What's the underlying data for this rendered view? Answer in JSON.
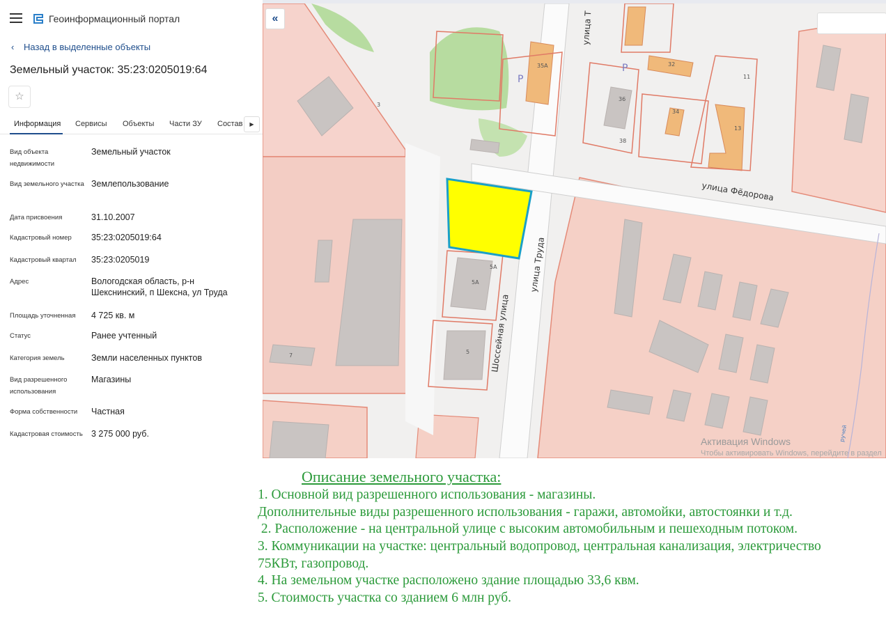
{
  "app": {
    "title": "Геоинформационный портал"
  },
  "panel": {
    "back_label": "Назад в выделенные объекты",
    "title": "Земельный участок: 35:23:0205019:64",
    "tabs": [
      "Информация",
      "Сервисы",
      "Объекты",
      "Части ЗУ",
      "Состав"
    ],
    "properties": [
      {
        "label": "Вид объекта недвижимости",
        "value": "Земельный участок"
      },
      {
        "label": "Вид земельного участка",
        "value": "Землепользование"
      },
      {
        "label": "Дата присвоения",
        "value": "31.10.2007"
      },
      {
        "label": "Кадастровый номер",
        "value": "35:23:0205019:64"
      },
      {
        "label": "Кадастровый квартал",
        "value": "35:23:0205019"
      },
      {
        "label": "Адрес",
        "value": "Вологодская область, р-н Шекснинский, п Шексна, ул Труда"
      },
      {
        "label": "Площадь уточненная",
        "value": "4 725 кв. м"
      },
      {
        "label": "Статус",
        "value": "Ранее учтенный"
      },
      {
        "label": "Категория земель",
        "value": "Земли населенных пунктов"
      },
      {
        "label": "Вид разрешенного использования",
        "value": "Магазины"
      },
      {
        "label": "Форма собственности",
        "value": "Частная"
      },
      {
        "label": "Кадастровая стоимость",
        "value": "3 275 000 руб."
      }
    ]
  },
  "map": {
    "streets": {
      "fedorova": "улица Фёдорова",
      "truda": "улица Труда",
      "truda_top": "улица Т",
      "shosseynaya": "Шоссейная улица",
      "ruchey": "ручей"
    },
    "building_numbers": [
      "35А",
      "32",
      "11",
      "36",
      "34",
      "13",
      "38",
      "3",
      "5А",
      "5А",
      "5",
      "7"
    ],
    "parking_label": "P",
    "watermark_title": "Активация Windows",
    "watermark_text": "Чтобы активировать Windows, перейдите в раздел"
  },
  "description": {
    "title": "Описание земельного участка:",
    "lines": [
      "1. Основной вид разрешенного использования - магазины.",
      "Дополнительные виды разрешенного использования - гаражи, автомойки, автостоянки и т.д.",
      " 2. Расположение - на центральной улице с высоким автомобильным и пешеходным потоком.",
      "3. Коммуникации на участке: центральный водопровод, центральная канализация, электричество",
      "75КВт, газопровод.",
      "4. На земельном участке расположено здание площадью 33,6 квм.",
      "5. Стоимость участка со зданием 6 млн руб."
    ]
  },
  "colors": {
    "accent": "#1f4e8c",
    "parcel_fill": "#ffff00",
    "parcel_border": "#1aa0c8",
    "description_text": "#2b9a3a"
  }
}
